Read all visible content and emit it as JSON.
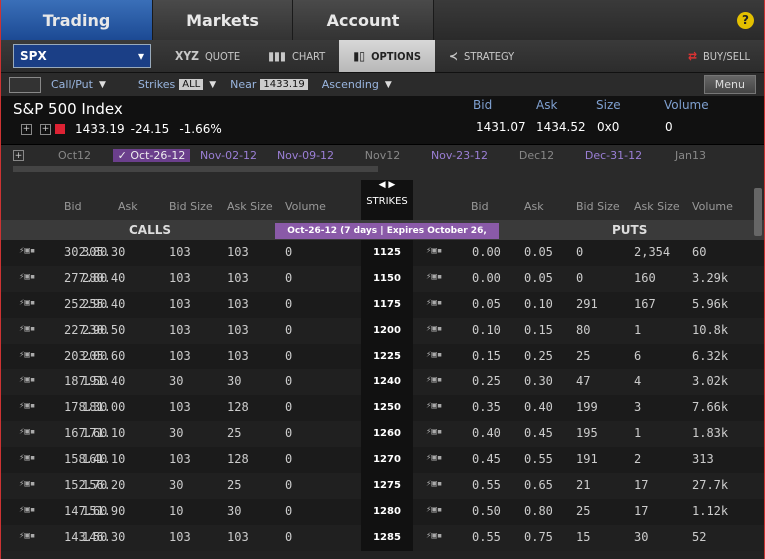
{
  "tabs": [
    "Trading",
    "Markets",
    "Account"
  ],
  "help_label": "?",
  "symbol": "SPX",
  "tools": {
    "quote": "QUOTE",
    "chart": "CHART",
    "options": "OPTIONS",
    "strategy": "STRATEGY",
    "buysell": "BUY/SELL"
  },
  "controls": {
    "callput": "Call/Put",
    "strikes_label": "Strikes",
    "strikes_value": "ALL",
    "near_label": "Near",
    "near_value": "1433.19",
    "sort": "Ascending",
    "menu": "Menu"
  },
  "index": {
    "name": "S&P 500 Index",
    "last": "1433.19",
    "change": "-24.15",
    "pct": "-1.66%",
    "hdr": {
      "bid": "Bid",
      "ask": "Ask",
      "size": "Size",
      "volume": "Volume"
    },
    "bid": "1431.07",
    "ask": "1434.52",
    "size": "0x0",
    "volume": "0"
  },
  "expirations": [
    {
      "label": "Oct12",
      "style": "grey"
    },
    {
      "label": "✓ Oct-26-12",
      "style": "sel"
    },
    {
      "label": "Nov-02-12",
      "style": "purple"
    },
    {
      "label": "Nov-09-12",
      "style": "purple"
    },
    {
      "label": "Nov12",
      "style": "grey"
    },
    {
      "label": "Nov-23-12",
      "style": "purple"
    },
    {
      "label": "Dec12",
      "style": "grey"
    },
    {
      "label": "Dec-31-12",
      "style": "purple"
    },
    {
      "label": "Jan13",
      "style": "grey"
    }
  ],
  "chain_headers": {
    "calls": [
      "Bid",
      "Ask",
      "Bid Size",
      "Ask Size",
      "Volume"
    ],
    "strikes": "STRIKES",
    "puts": [
      "Bid",
      "Ask",
      "Bid Size",
      "Ask Size",
      "Volume"
    ]
  },
  "section": {
    "calls": "CALLS",
    "puts": "PUTS",
    "exp_tag": "Oct-26-12   (7 days | Expires October 26, 2012)"
  },
  "rows": [
    {
      "strike": "1125",
      "cb": "302.80",
      "ca": "305.30",
      "cbs": "103",
      "cas": "103",
      "cv": "0",
      "pb": "0.00",
      "pa": "0.05",
      "pbs": "0",
      "pas": "2,354",
      "pv": "60"
    },
    {
      "strike": "1150",
      "cb": "277.80",
      "ca": "280.40",
      "cbs": "103",
      "cas": "103",
      "cv": "0",
      "pb": "0.00",
      "pa": "0.05",
      "pbs": "0",
      "pas": "160",
      "pv": "3.29k"
    },
    {
      "strike": "1175",
      "cb": "252.90",
      "ca": "255.40",
      "cbs": "103",
      "cas": "103",
      "cv": "0",
      "pb": "0.05",
      "pa": "0.10",
      "pbs": "291",
      "pas": "167",
      "pv": "5.96k"
    },
    {
      "strike": "1200",
      "cb": "227.90",
      "ca": "230.50",
      "cbs": "103",
      "cas": "103",
      "cv": "0",
      "pb": "0.10",
      "pa": "0.15",
      "pbs": "80",
      "pas": "1",
      "pv": "10.8k"
    },
    {
      "strike": "1225",
      "cb": "203.00",
      "ca": "205.60",
      "cbs": "103",
      "cas": "103",
      "cv": "0",
      "pb": "0.15",
      "pa": "0.25",
      "pbs": "25",
      "pas": "6",
      "pv": "6.32k"
    },
    {
      "strike": "1240",
      "cb": "187.50",
      "ca": "191.40",
      "cbs": "30",
      "cas": "30",
      "cv": "0",
      "pb": "0.25",
      "pa": "0.30",
      "pbs": "47",
      "pas": "4",
      "pv": "3.02k"
    },
    {
      "strike": "1250",
      "cb": "178.30",
      "ca": "181.00",
      "cbs": "103",
      "cas": "128",
      "cv": "0",
      "pb": "0.35",
      "pa": "0.40",
      "pbs": "199",
      "pas": "3",
      "pv": "7.66k"
    },
    {
      "strike": "1260",
      "cb": "167.60",
      "ca": "171.10",
      "cbs": "30",
      "cas": "25",
      "cv": "0",
      "pb": "0.40",
      "pa": "0.45",
      "pbs": "195",
      "pas": "1",
      "pv": "1.83k"
    },
    {
      "strike": "1270",
      "cb": "158.40",
      "ca": "161.10",
      "cbs": "103",
      "cas": "128",
      "cv": "0",
      "pb": "0.45",
      "pa": "0.55",
      "pbs": "191",
      "pas": "2",
      "pv": "313"
    },
    {
      "strike": "1275",
      "cb": "152.70",
      "ca": "156.20",
      "cbs": "30",
      "cas": "25",
      "cv": "0",
      "pb": "0.55",
      "pa": "0.65",
      "pbs": "21",
      "pas": "17",
      "pv": "27.7k"
    },
    {
      "strike": "1280",
      "cb": "147.60",
      "ca": "151.90",
      "cbs": "10",
      "cas": "30",
      "cv": "0",
      "pb": "0.50",
      "pa": "0.80",
      "pbs": "25",
      "pas": "17",
      "pv": "1.12k"
    },
    {
      "strike": "1285",
      "cb": "143.50",
      "ca": "146.30",
      "cbs": "103",
      "cas": "103",
      "cv": "0",
      "pb": "0.55",
      "pa": "0.75",
      "pbs": "15",
      "pas": "30",
      "pv": "52"
    }
  ]
}
